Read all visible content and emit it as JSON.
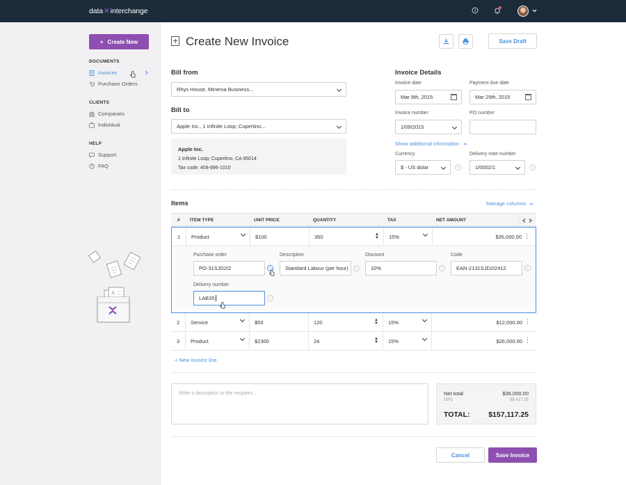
{
  "app": {
    "logo_left": "data",
    "logo_x": "✕",
    "logo_right": "interchange"
  },
  "colors": {
    "topbar": "#1b2b3a",
    "accent": "#8e4fb0",
    "link": "#4a90e2"
  },
  "sidebar": {
    "create_label": "Create New",
    "sections": [
      {
        "title": "DOCUMENTS",
        "items": [
          {
            "label": "Invoices",
            "icon": "invoice-icon"
          },
          {
            "label": "Purchase Orders",
            "icon": "cart-icon"
          }
        ]
      },
      {
        "title": "CLIENTS",
        "items": [
          {
            "label": "Companies",
            "icon": "building-icon"
          },
          {
            "label": "Individual",
            "icon": "user-card-icon"
          }
        ]
      },
      {
        "title": "HELP",
        "items": [
          {
            "label": "Support",
            "icon": "chat-icon"
          },
          {
            "label": "FAQ",
            "icon": "question-icon"
          }
        ]
      }
    ]
  },
  "header": {
    "title": "Create New Invoice",
    "save_draft": "Save Draft"
  },
  "bill_from": {
    "title": "Bill from",
    "value": "Rhys House, Minerva Business..."
  },
  "bill_to": {
    "title": "Bill to",
    "value": "Apple Inc., 1 Infinite Loop; Cupertino...",
    "address_name": "Apple Inc.",
    "address_line": "1 Infinite Loop; Cupertino, CA 95014",
    "tax_code": "Tax code: 408-996-1010"
  },
  "details": {
    "title": "Invoice Details",
    "invoice_date_label": "Invoice date",
    "invoice_date": "Mar 8th, 2015",
    "due_date_label": "Payment due date",
    "due_date": "Mar 29th, 2015",
    "invoice_number_label": "Invoice number",
    "invoice_number": "1/09/2015",
    "po_number_label": "PO number",
    "po_number": "",
    "show_more": "Show additional information",
    "currency_label": "Currency",
    "currency": "$ - US dolar",
    "delivery_note_label": "Delivery note number",
    "delivery_note": "1/0002/1"
  },
  "items": {
    "title": "Items",
    "manage_columns": "Manage columns",
    "columns": [
      "#",
      "ITEM TYPE",
      "UNIT PRICE",
      "QUANTITY",
      "TAX",
      "NET AMOUNT"
    ],
    "rows": [
      {
        "num": "1",
        "type": "Product",
        "price": "$100",
        "qty": "350",
        "tax": "15%",
        "amount": "$35,000.00"
      },
      {
        "num": "2",
        "type": "Service",
        "price": "$50",
        "qty": "120",
        "tax": "15%",
        "amount": "$12,000.00"
      },
      {
        "num": "3",
        "type": "Product",
        "price": "$2300",
        "qty": "24",
        "tax": "15%",
        "amount": "$26,000.00"
      }
    ],
    "expanded": {
      "po_label": "Purchase order",
      "po_value": "PO-31SJD2I2",
      "desc_label": "Description",
      "desc_value": "Standard Labour (per hour)",
      "discount_label": "Discount",
      "discount_value": "10%",
      "code_label": "Code",
      "code_value": "EAN-2131SJD2I2412",
      "delivery_label": "Delivery number",
      "delivery_value": "LAB35"
    },
    "new_line": "New invoice line"
  },
  "footer": {
    "desc_placeholder": "Write a description to the recipient...",
    "net_total_label": "Net total",
    "net_total": "$36,000.00",
    "dip_label": "DIP1",
    "dip_value": "$8,417.25",
    "total_label": "TOTAL:",
    "total_value": "$157,117.25",
    "cancel": "Cancel",
    "save": "Save Invoice"
  }
}
